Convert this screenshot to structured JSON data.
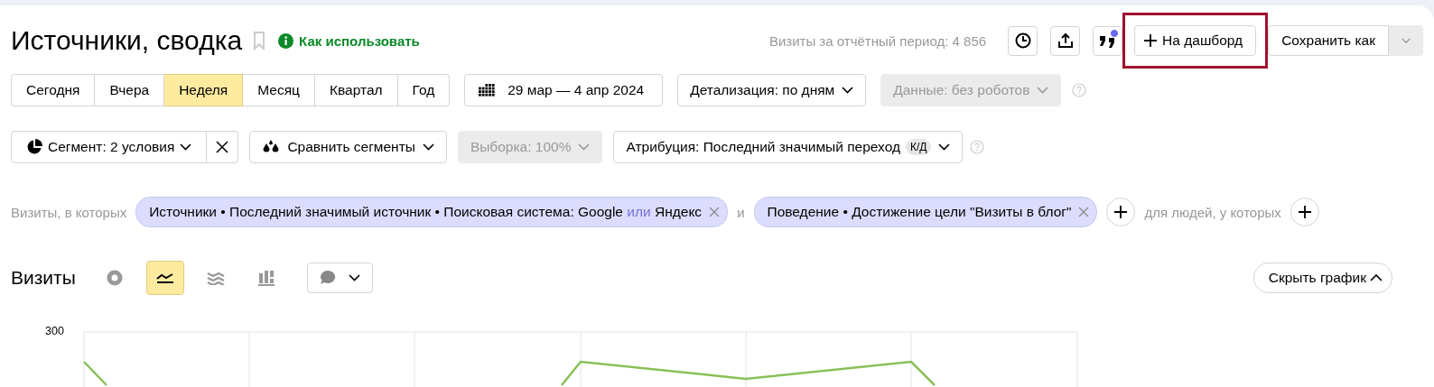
{
  "header": {
    "title": "Источники, сводка",
    "help_link": "Как использовать",
    "visits_summary": "Визиты за отчётный период: 4 856",
    "comments_badge": true,
    "dashboard_button": {
      "label": "На дашборд",
      "highlighted": true
    },
    "save_button": "Сохранить как"
  },
  "periods": [
    {
      "label": "Сегодня",
      "selected": false
    },
    {
      "label": "Вчера",
      "selected": false
    },
    {
      "label": "Неделя",
      "selected": true
    },
    {
      "label": "Месяц",
      "selected": false
    },
    {
      "label": "Квартал",
      "selected": false
    },
    {
      "label": "Год",
      "selected": false
    }
  ],
  "date_range": "29 мар — 4 апр 2024",
  "detail": {
    "label": "Детализация: по дням",
    "disabled": false
  },
  "data_filter": {
    "label": "Данные: без роботов",
    "disabled": true
  },
  "segment": "Сегмент: 2 условия",
  "compare": "Сравнить сегменты",
  "sample": {
    "label": "Выборка: 100%",
    "disabled": true
  },
  "attribution": {
    "label": "Атрибуция: Последний значимый переход",
    "badge": "К/Д"
  },
  "conditions": {
    "prefix": "Визиты, в которых",
    "chips": [
      {
        "parts": [
          {
            "kind": "text",
            "text": "Источники • Последний значимый источник • Поисковая система: Google"
          },
          {
            "kind": "operator",
            "text": "или"
          },
          {
            "kind": "text",
            "text": "Яндекс"
          }
        ]
      },
      {
        "parts": [
          {
            "kind": "text",
            "text": "Поведение • Достижение цели \"Визиты в блог\""
          }
        ]
      }
    ],
    "joiner": "и",
    "people_label": "для людей, у которых"
  },
  "chart_section": {
    "title": "Визиты",
    "chart_types": [
      {
        "kind": "pie",
        "selected": false
      },
      {
        "kind": "line",
        "selected": true
      },
      {
        "kind": "area",
        "selected": false
      },
      {
        "kind": "bar",
        "selected": false
      }
    ],
    "hide_button": "Скрыть график",
    "y_tick": "300"
  }
}
